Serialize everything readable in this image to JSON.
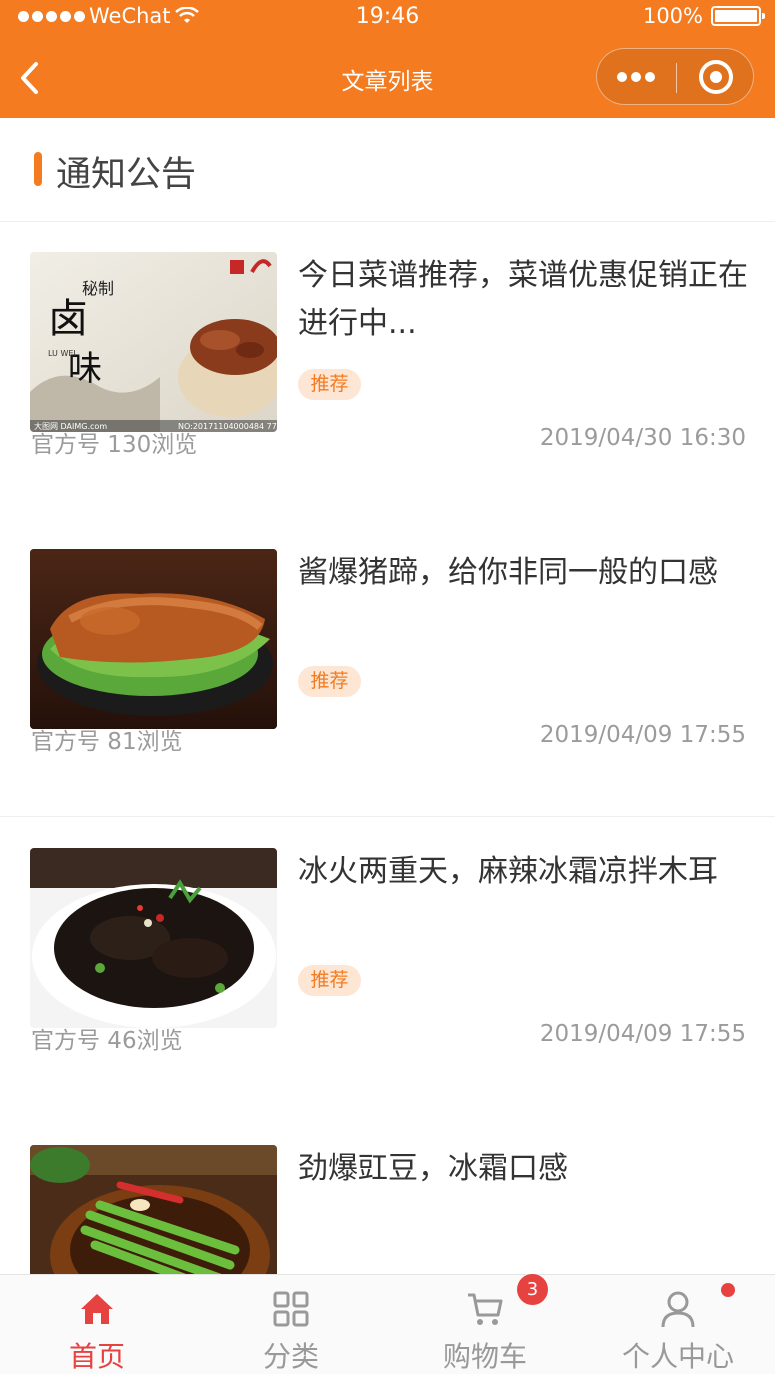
{
  "status_bar": {
    "carrier": "WeChat",
    "time": "19:46",
    "battery": "100%"
  },
  "nav": {
    "title": "文章列表",
    "back_icon": "chevron-left-icon",
    "more_icon": "more-dots-icon",
    "close_icon": "target-circle-icon"
  },
  "section": {
    "title": "通知公告",
    "accent": "#f47b20"
  },
  "articles": [
    {
      "title": "今日菜谱推荐，菜谱优惠促销正在进行中...",
      "tag": "推荐",
      "source_views": "官方号 130浏览",
      "date": "2019/04/30 16:30",
      "thumb_texts": [
        "秘制",
        "卤",
        "味",
        "LU WEI",
        "大图网 DAIMG.com",
        "NO:20171104000484 77"
      ]
    },
    {
      "title": "酱爆猪蹄，给你非同一般的口感",
      "tag": "推荐",
      "source_views": "官方号 81浏览",
      "date": "2019/04/09 17:55"
    },
    {
      "title": "冰火两重天，麻辣冰霜凉拌木耳",
      "tag": "推荐",
      "source_views": "官方号 46浏览",
      "date": "2019/04/09 17:55"
    },
    {
      "title": "劲爆豇豆，冰霜口感"
    }
  ],
  "tabbar": {
    "items": [
      {
        "label": "首页",
        "icon": "home-icon",
        "active": true
      },
      {
        "label": "分类",
        "icon": "grid-icon",
        "active": false
      },
      {
        "label": "购物车",
        "icon": "cart-icon",
        "active": false
      },
      {
        "label": "个人中心",
        "icon": "user-icon",
        "active": false
      }
    ],
    "cart_badge": "3",
    "active_color": "#e64340",
    "inactive_color": "#999999"
  }
}
